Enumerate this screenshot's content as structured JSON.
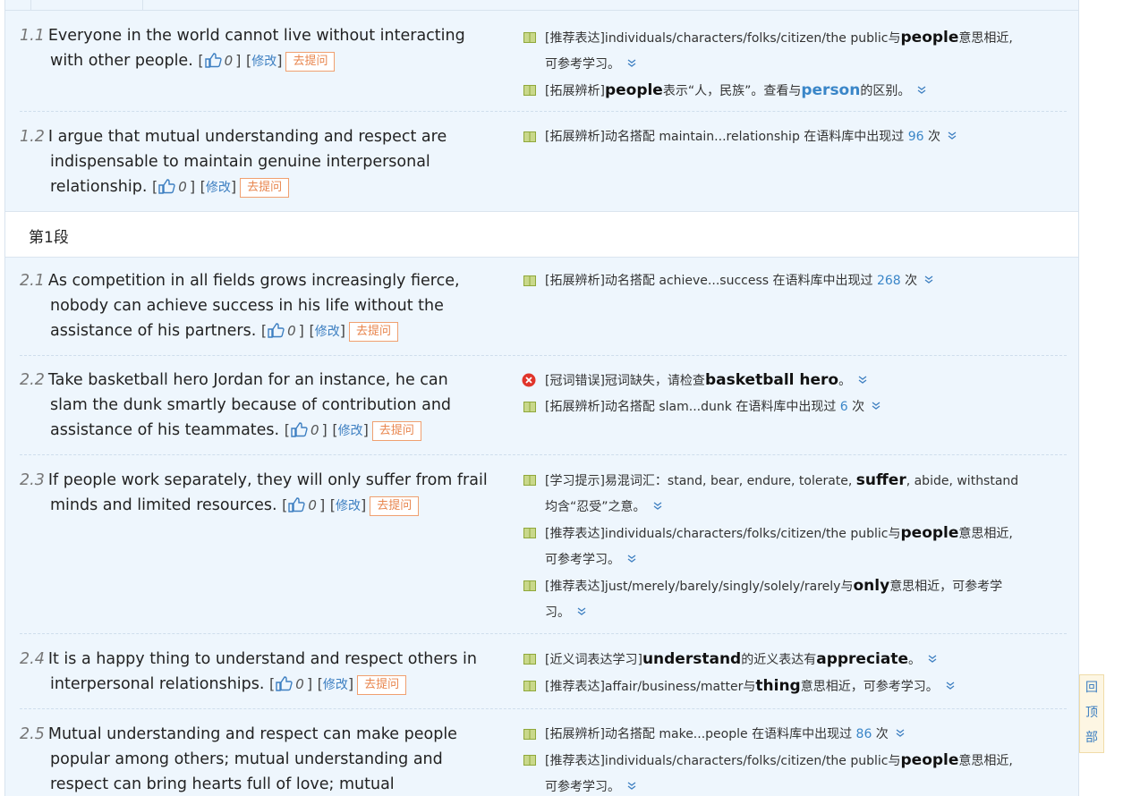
{
  "ui": {
    "edit_label": "修改",
    "ask_label": "去提问",
    "like_count": "0",
    "bracket_open": "[",
    "bracket_close": "]",
    "paragraph_label": "第1段",
    "to_top": [
      "回",
      "顶",
      "部"
    ]
  },
  "sentences": [
    {
      "num": "1.1",
      "lines": [
        "Everyone in the world cannot live without interacting",
        "with other people."
      ]
    },
    {
      "num": "1.2",
      "lines": [
        "I argue that mutual understanding and respect are",
        "indispensable to maintain genuine interpersonal",
        "relationship."
      ]
    },
    {
      "num": "2.1",
      "lines": [
        "As competition in all fields grows increasingly fierce,",
        "nobody can achieve success in his life without the",
        "assistance of his partners."
      ]
    },
    {
      "num": "2.2",
      "lines": [
        "Take basketball hero Jordan for an instance, he can",
        "slam the dunk smartly because of contribution and",
        "assistance of his teammates."
      ]
    },
    {
      "num": "2.3",
      "lines": [
        "If people work separately, they will only suffer from frail",
        "minds and limited resources."
      ]
    },
    {
      "num": "2.4",
      "lines": [
        "It is a happy thing to understand and respect others in",
        "interpersonal relationships."
      ]
    },
    {
      "num": "2.5",
      "lines": [
        "Mutual understanding and respect can make people",
        "popular among others; mutual understanding and",
        "respect can bring hearts full of love; mutual"
      ]
    }
  ],
  "notes": {
    "n11a": {
      "pre": "[推荐表达]individuals/characters/folks/citizen/the public与",
      "kw": "people",
      "post": "意思相近,",
      "line2": "可参考学习。"
    },
    "n11b": {
      "pre": "[拓展辨析]",
      "kw": "people",
      "mid": "表示“人，民族”。查看与",
      "kw2": "person",
      "post": "的区别。"
    },
    "n12a": {
      "pre": "[拓展辨析]动名搭配 maintain...relationship 在语料库中出现过 ",
      "count": "96",
      "post": " 次"
    },
    "n21a": {
      "pre": "[拓展辨析]动名搭配 achieve...success 在语料库中出现过 ",
      "count": "268",
      "post": " 次"
    },
    "n22a": {
      "pre": "[冠词错误]冠词缺失，请检查",
      "kw": "basketball hero",
      "post": "。"
    },
    "n22b": {
      "pre": "[拓展辨析]动名搭配 slam...dunk 在语料库中出现过 ",
      "count": "6",
      "post": " 次"
    },
    "n23a": {
      "pre": "[学习提示]易混词汇：stand, bear, endure, tolerate, ",
      "kw": "suffer",
      "post": ", abide, withstand",
      "line2": "均含“忍受”之意。"
    },
    "n23b": {
      "pre": "[推荐表达]individuals/characters/folks/citizen/the public与",
      "kw": "people",
      "post": "意思相近,",
      "line2": "可参考学习。"
    },
    "n23c": {
      "pre": "[推荐表达]just/merely/barely/singly/solely/rarely与",
      "kw": "only",
      "post": "意思相近，可参考学",
      "line2": "习。"
    },
    "n24a": {
      "pre": "[近义词表达学习]",
      "kw": "understand",
      "mid": "的近义表达有",
      "kw2": "appreciate",
      "post": "。"
    },
    "n24b": {
      "pre": "[推荐表达]affair/business/matter与",
      "kw": "thing",
      "post": "意思相近，可参考学习。"
    },
    "n25a": {
      "pre": "[拓展辨析]动名搭配 make...people 在语料库中出现过 ",
      "count": "86",
      "post": " 次"
    },
    "n25b": {
      "pre": "[推荐表达]individuals/characters/folks/citizen/the public与",
      "kw": "people",
      "post": "意思相近,",
      "line2": "可参考学习。"
    }
  },
  "colors": {
    "panel": "#eef6fd",
    "link": "#3a86c8",
    "ask": "#e8854d",
    "error": "#e0352b",
    "book": "#8fa83a"
  },
  "icons": {
    "like": "thumbs-up-icon",
    "book": "book-icon",
    "error": "error-icon",
    "expand": "chevron-double-down-icon"
  }
}
